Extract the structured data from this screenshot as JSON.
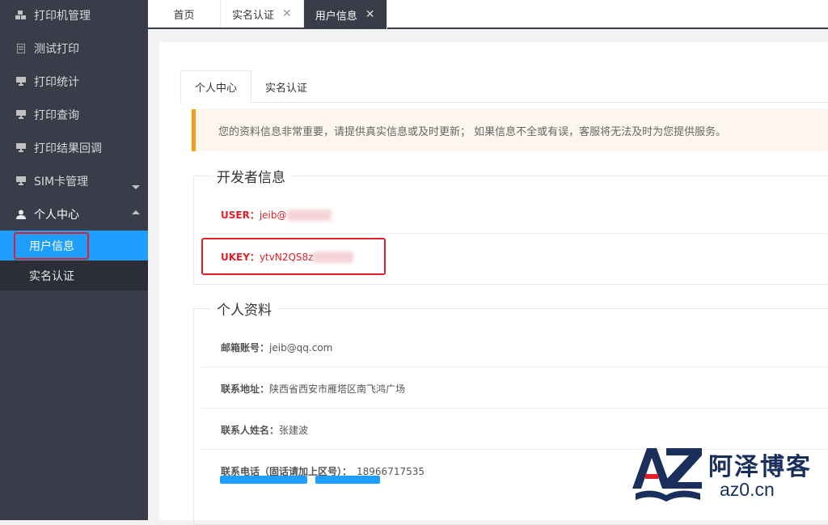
{
  "sidebar": {
    "items": [
      {
        "label": "打印机管理",
        "icon": "cubes-icon"
      },
      {
        "label": "测试打印",
        "icon": "file-icon"
      },
      {
        "label": "打印统计",
        "icon": "monitor-icon"
      },
      {
        "label": "打印查询",
        "icon": "monitor-icon"
      },
      {
        "label": "打印结果回调",
        "icon": "monitor-icon"
      },
      {
        "label": "SIM卡管理",
        "icon": "monitor-icon"
      },
      {
        "label": "个人中心",
        "icon": "user-icon"
      }
    ],
    "subitems": [
      {
        "label": "用户信息",
        "active": true
      },
      {
        "label": "实名认证",
        "active": false
      }
    ]
  },
  "tabs": [
    {
      "label": "首页",
      "closable": false
    },
    {
      "label": "实名认证",
      "closable": true
    },
    {
      "label": "用户信息",
      "closable": true,
      "active": true
    }
  ],
  "page_tabs": [
    "个人中心",
    "实名认证"
  ],
  "notice": "您的资料信息非常重要，请提供真实信息或及时更新；  如果信息不全或有误，客服将无法及时为您提供服务。",
  "developer": {
    "legend": "开发者信息",
    "user_label": "USER：",
    "user_value": "jeib@",
    "ukey_label": "UKEY：",
    "ukey_value": "ytvN2QS8z"
  },
  "profile": {
    "legend": "个人资料",
    "email_label": "邮箱账号：",
    "email_value": "jeib@qq.com",
    "address_label": "联系地址：",
    "address_value": "陕西省西安市雁塔区南飞鸿广场",
    "name_label": "联系人姓名：",
    "name_value": "张建波",
    "phone_label": "联系电话（固话请加上区号）：",
    "phone_value": "18966717535"
  },
  "watermark": {
    "logo_text": "AZ",
    "cn": "阿泽博客",
    "url": "az0.cn"
  },
  "colors": {
    "sidebar_bg": "#393d49",
    "active_blue": "#1e9fff",
    "highlight_red": "#e3202a",
    "notice_orange": "#f59c1a"
  }
}
